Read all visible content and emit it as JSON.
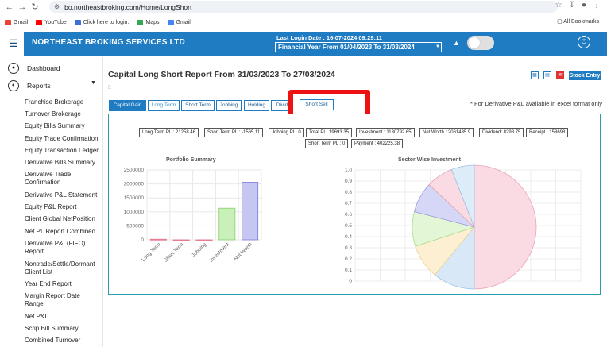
{
  "browser": {
    "url": "bo.northeastbroking.com/Home/LongShort",
    "bookmarks": [
      "Gmail",
      "YouTube",
      "Click here to login.",
      "Maps",
      "Gmail"
    ],
    "all_bookmarks": "All Bookmarks"
  },
  "header": {
    "brand": "NORTHEAST BROKING SERVICES LTD",
    "last_login": "Last Login Date : 16-07-2024 09:29:11",
    "financial_year": "Financial Year From 01/04/2023 To 31/03/2024"
  },
  "sidebar": {
    "dashboard": "Dashboard",
    "reports": "Reports",
    "items": [
      "Franchise Brokerage",
      "Turnover Brokerage",
      "Equity Bills Summary",
      "Equity Trade Confirmation",
      "Equity Transaction Ledger",
      "Derivative Bills Summary",
      "Derivative Trade Confirmation",
      "Derivative P&L Statement",
      "Equity P&L Report",
      "Client Global NetPosition",
      "Net PL Report Combined",
      "Derivative P&L(FIFO) Report",
      "Nontrade/Settle/Dormant Client List",
      "Year End Report",
      "Margin Report Date Range",
      "Net P&L",
      "Scrip Bill Summary",
      "Combined Turnover"
    ]
  },
  "main": {
    "title": "Capital Long Short Report From 31/03/2023 To 27/03/2024",
    "subtitle": "E",
    "stock_entry": "Stock Entry",
    "tabs": [
      "Capital Gain",
      "Long Term",
      "Short Term",
      "Jobbing",
      "Holding",
      "Divid",
      "Short Sell"
    ],
    "note": "* For Derivative P&L available in excel format only",
    "stats": [
      "Long Term PL : 21258.46",
      "Short Term PL : -1565.11",
      "Jobbing PL: 0",
      "Total PL: 19693.35",
      "Investment : 1130792.65",
      "Net Worth : 2061435.9",
      "Dividend: 8298.75",
      "Receipt : 158698",
      "Short Term PL : 0",
      "Payment : 402225.38"
    ]
  },
  "chart_data": [
    {
      "type": "bar",
      "title": "Portfolio Summary",
      "categories": [
        "Long Term",
        "Short Term",
        "Jobbing",
        "Investment",
        "Net Worth"
      ],
      "values": [
        21258.46,
        -1565.11,
        0,
        1130792.65,
        2061435.9
      ],
      "yticks": [
        "0",
        "500000",
        "1000000",
        "1500000",
        "2000000",
        "2500000"
      ],
      "ylim": [
        0,
        2500000
      ],
      "colors": [
        "#f4b6c2",
        "#f4b6c2",
        "#f4b6c2",
        "#c8f0b8",
        "#c6c6f2"
      ],
      "border_colors": [
        "#e36d86",
        "#e36d86",
        "#e36d86",
        "#86cf6c",
        "#7c7ce0"
      ]
    },
    {
      "type": "pie",
      "title": "Sector Wise Investment",
      "yticks": [
        "0",
        "0.1",
        "0.2",
        "0.3",
        "0.4",
        "0.5",
        "0.6",
        "0.7",
        "0.8",
        "0.9",
        "1.0"
      ],
      "slices": [
        0.5,
        0.11,
        0.09,
        0.09,
        0.08,
        0.07,
        0.06
      ],
      "colors": [
        "#fadbe3",
        "#d8e8f7",
        "#fdf0d2",
        "#e3f6d6",
        "#d6d6f6",
        "#fadbe3",
        "#dcecf8"
      ],
      "border_colors": [
        "#e8a3b3",
        "#9bc3e6",
        "#ecd49a",
        "#a9dd90",
        "#9a9ae2",
        "#e8a3b3",
        "#9bc3e6"
      ]
    }
  ]
}
